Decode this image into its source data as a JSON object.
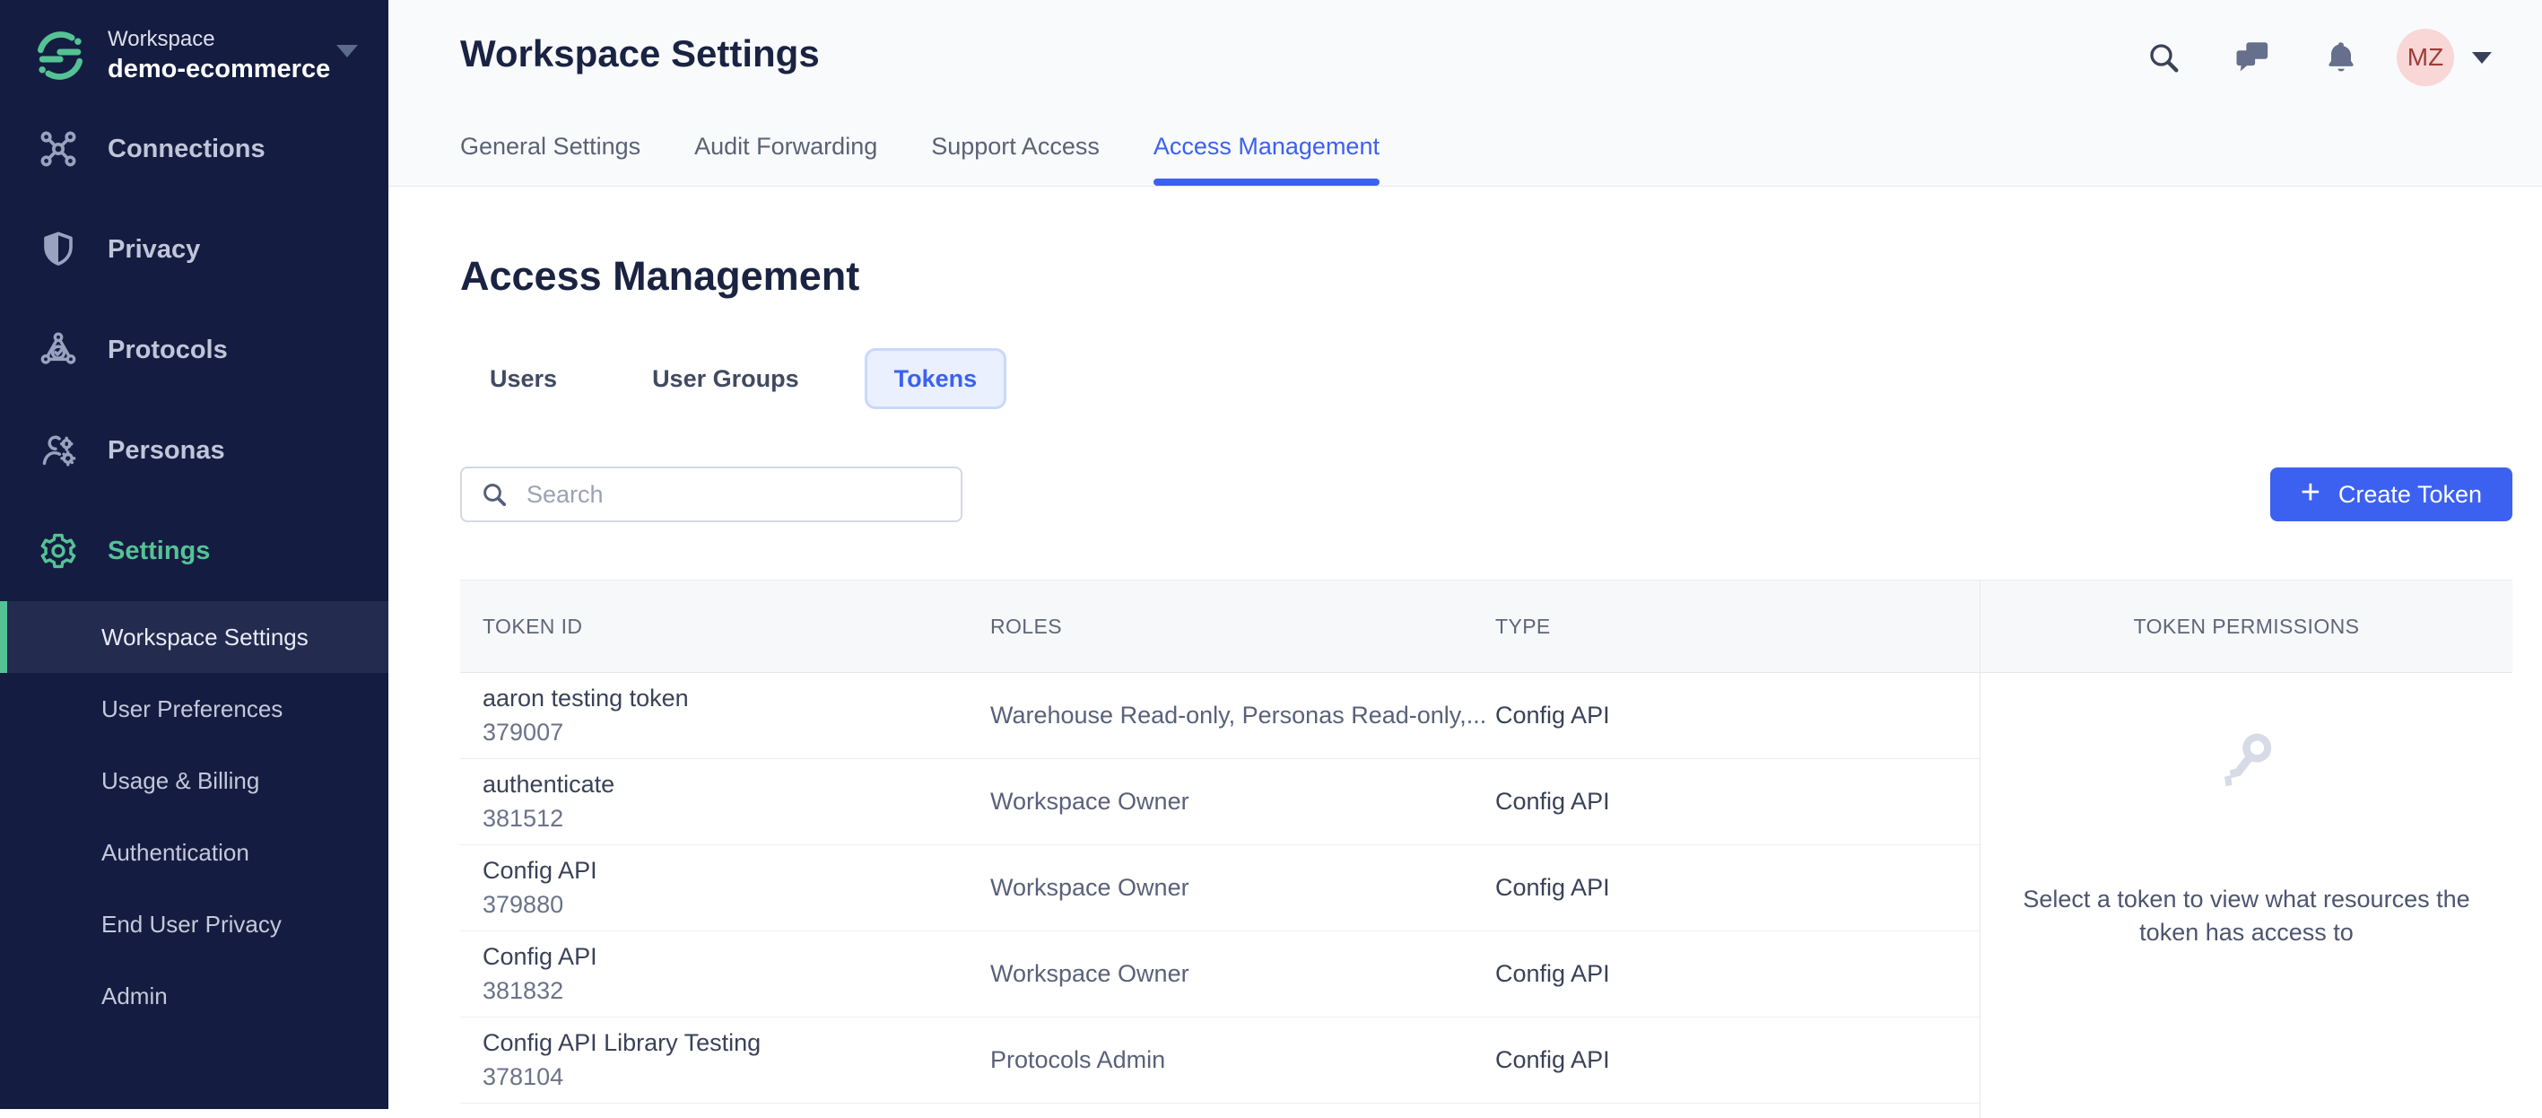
{
  "colors": {
    "sidebar_bg": "#151C41",
    "sidebar_active_bg": "#232B4F",
    "accent_green": "#55C295",
    "accent_blue": "#3C61F0",
    "pill_bg": "#EAF0FE",
    "avatar_bg": "#F8D7D6",
    "avatar_text": "#A03B37",
    "table_header_bg": "#F7F8FA"
  },
  "workspace": {
    "label": "Workspace",
    "name": "demo-ecommerce",
    "caret_icon": "chevron-down-icon"
  },
  "sidebar": {
    "items": [
      {
        "label": "Connections",
        "icon": "connections-icon"
      },
      {
        "label": "Privacy",
        "icon": "privacy-shield-icon"
      },
      {
        "label": "Protocols",
        "icon": "protocols-icon"
      },
      {
        "label": "Personas",
        "icon": "personas-icon"
      },
      {
        "label": "Settings",
        "icon": "settings-gear-icon"
      }
    ],
    "subitems": [
      {
        "label": "Workspace Settings"
      },
      {
        "label": "User Preferences"
      },
      {
        "label": "Usage & Billing"
      },
      {
        "label": "Authentication"
      },
      {
        "label": "End User Privacy"
      },
      {
        "label": "Admin"
      }
    ]
  },
  "topbar": {
    "title": "Workspace Settings",
    "tabs": [
      {
        "label": "General Settings"
      },
      {
        "label": "Audit Forwarding"
      },
      {
        "label": "Support Access"
      },
      {
        "label": "Access Management"
      }
    ],
    "icons": [
      "search-icon",
      "chat-icon",
      "bell-icon"
    ],
    "avatar_initials": "MZ"
  },
  "page": {
    "title": "Access Management",
    "tabs": [
      {
        "label": "Users"
      },
      {
        "label": "User Groups"
      },
      {
        "label": "Tokens"
      }
    ]
  },
  "search": {
    "placeholder": "Search"
  },
  "create_button": {
    "plus": "+",
    "label": "Create Token"
  },
  "table": {
    "columns": [
      "TOKEN ID",
      "ROLES",
      "TYPE"
    ],
    "rows": [
      {
        "name": "aaron testing token",
        "id": "379007",
        "roles": "Warehouse Read-only, Personas Read-only,...",
        "type": "Config API"
      },
      {
        "name": "authenticate",
        "id": "381512",
        "roles": "Workspace Owner",
        "type": "Config API"
      },
      {
        "name": "Config API",
        "id": "379880",
        "roles": "Workspace Owner",
        "type": "Config API"
      },
      {
        "name": "Config API",
        "id": "381832",
        "roles": "Workspace Owner",
        "type": "Config API"
      },
      {
        "name": "Config API Library Testing",
        "id": "378104",
        "roles": "Protocols Admin",
        "type": "Config API"
      }
    ]
  },
  "panel": {
    "header": "TOKEN PERMISSIONS",
    "empty_icon": "key-icon",
    "empty_text": "Select a token to view what resources the token has access to"
  }
}
